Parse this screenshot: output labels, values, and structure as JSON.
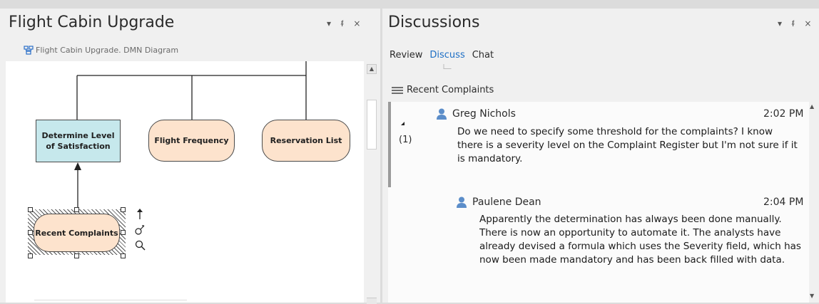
{
  "left": {
    "title": "Flight Cabin Upgrade",
    "controls": {
      "dropdown": "▾",
      "pin": "ᵮ",
      "close": "×"
    },
    "breadcrumb": "Flight Cabin Upgrade.  DMN Diagram",
    "diagram": {
      "decision": "Determine Level of Satisfaction",
      "knowledge_1": "Flight Frequency",
      "knowledge_2": "Reservation List",
      "selected_node": "Recent Complaints"
    }
  },
  "right": {
    "title": "Discussions",
    "controls": {
      "dropdown": "▾",
      "pin": "ᵮ",
      "close": "×"
    },
    "tabs": [
      "Review",
      "Discuss",
      "Chat"
    ],
    "active_tab": "Discuss",
    "section": "Recent Complaints",
    "messages": [
      {
        "author": "Greg Nichols",
        "time": "2:02 PM",
        "reply_count": "(1)",
        "text": "Do we need to specify some threshold for the complaints?  I know there is a severity level on the Complaint Register but I'm not sure if it is mandatory."
      },
      {
        "author": "Paulene Dean",
        "time": "2:04 PM",
        "text": "Apparently the determination has always been done manually. There is now an opportunity to automate it. The analysts have already devised a formula which uses the Severity field, which has now been made mandatory and has been back filled with data."
      }
    ]
  },
  "colors": {
    "decision_fill": "#c6e8ec",
    "knowledge_fill": "#fde3cd",
    "accent": "#1e6fc5",
    "avatar": "#5b8dc9"
  },
  "icons": [
    "diagram-icon",
    "arrow-up-icon",
    "link-icon",
    "search-icon",
    "menu-icon",
    "user-icon",
    "collapse-triangle-icon"
  ]
}
